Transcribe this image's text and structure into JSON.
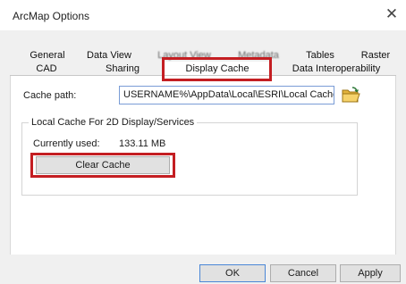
{
  "window": {
    "title": "ArcMap Options",
    "close_glyph": "✕"
  },
  "tabs": {
    "row_back": [
      "General",
      "Data View",
      "Layout View",
      "Metadata",
      "Tables",
      "Raster"
    ],
    "row_front": [
      "CAD",
      "Sharing",
      "Display Cache",
      "Data Interoperability"
    ],
    "active": "Display Cache"
  },
  "cache": {
    "path_label": "Cache path:",
    "path_value": "USERNAME%\\AppData\\Local\\ESRI\\Local Caches",
    "folder_icon": "open-folder-icon"
  },
  "local_cache": {
    "group_title": "Local Cache For 2D Display/Services",
    "used_label": "Currently used:",
    "used_value": "133.11 MB",
    "clear_label": "Clear Cache"
  },
  "footer": {
    "ok": "OK",
    "cancel": "Cancel",
    "apply": "Apply"
  },
  "colors": {
    "highlight": "#c41e22",
    "dialog_bg": "#f0f0f0",
    "panel_bg": "#ffffff"
  }
}
